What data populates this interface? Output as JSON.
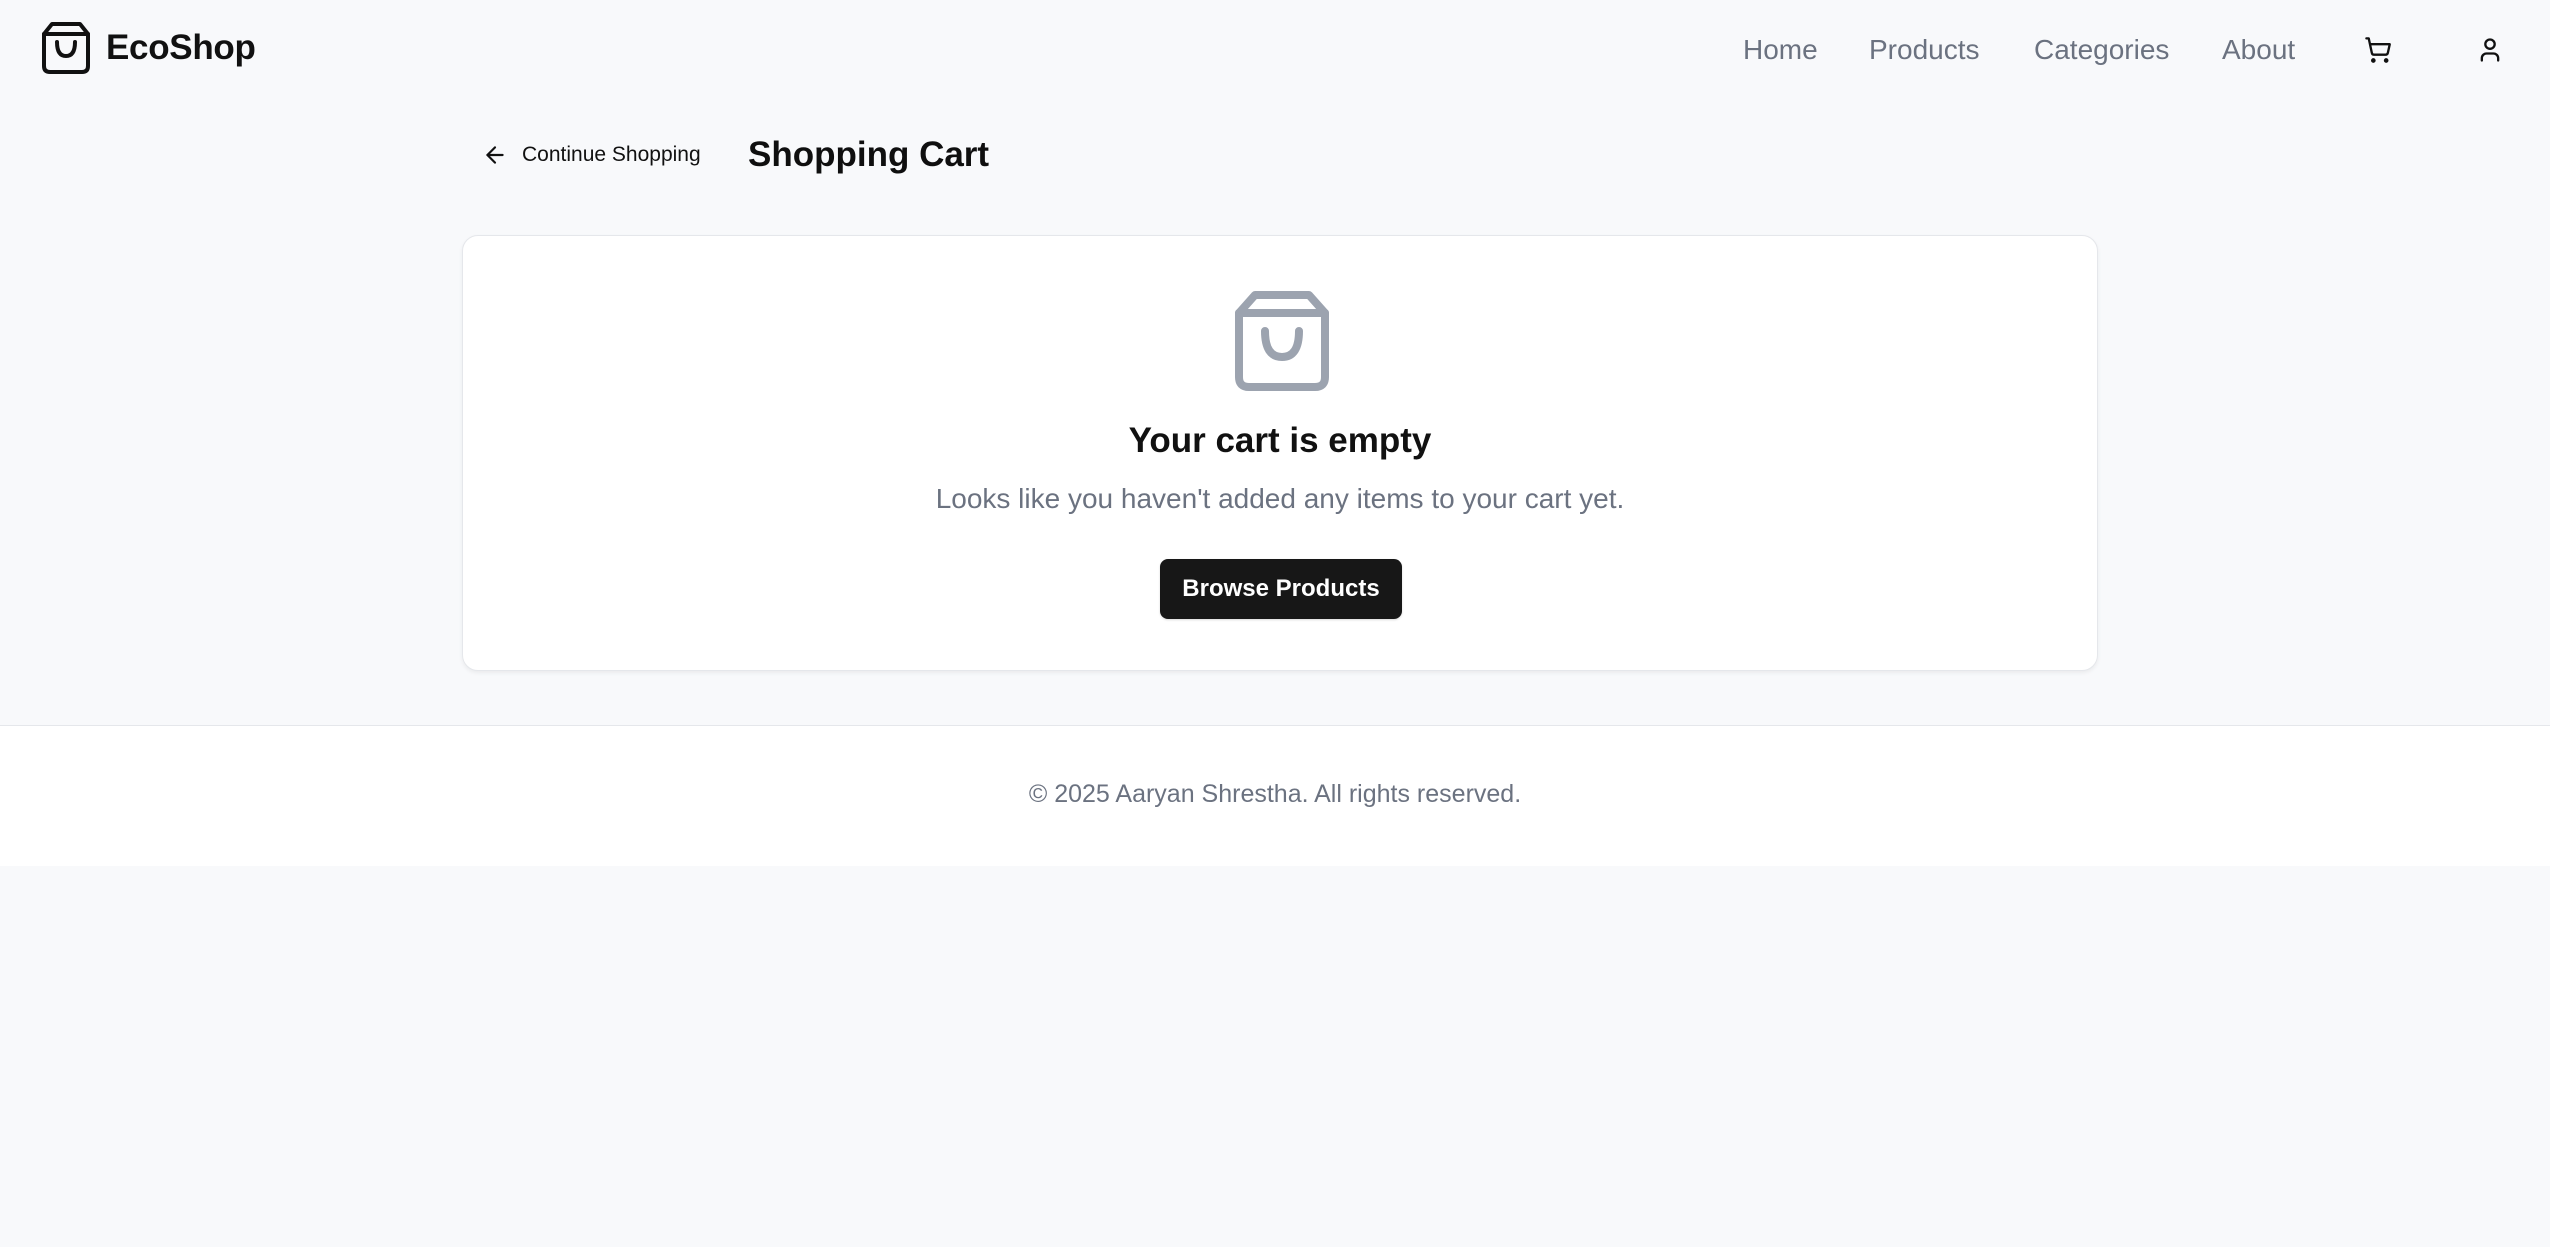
{
  "header": {
    "brand": "EcoShop",
    "brand_icon": "shopping-bag-icon",
    "nav": {
      "home": "Home",
      "products": "Products",
      "categories": "Categories",
      "about": "About"
    },
    "cart_icon": "cart-icon",
    "user_icon": "user-icon"
  },
  "page": {
    "back_label": "Continue Shopping",
    "back_icon": "arrow-left-icon",
    "title": "Shopping Cart"
  },
  "empty_cart": {
    "icon": "shopping-bag-icon",
    "title": "Your cart is empty",
    "message": "Looks like you haven't added any items to your cart yet.",
    "button_label": "Browse Products"
  },
  "footer": {
    "copyright": "© 2025 Aaryan Shrestha. All rights reserved."
  },
  "colors": {
    "background": "#f8f9fb",
    "primary_button": "#171717",
    "muted_text": "#6b7280",
    "icon_gray": "#9ca3af"
  }
}
